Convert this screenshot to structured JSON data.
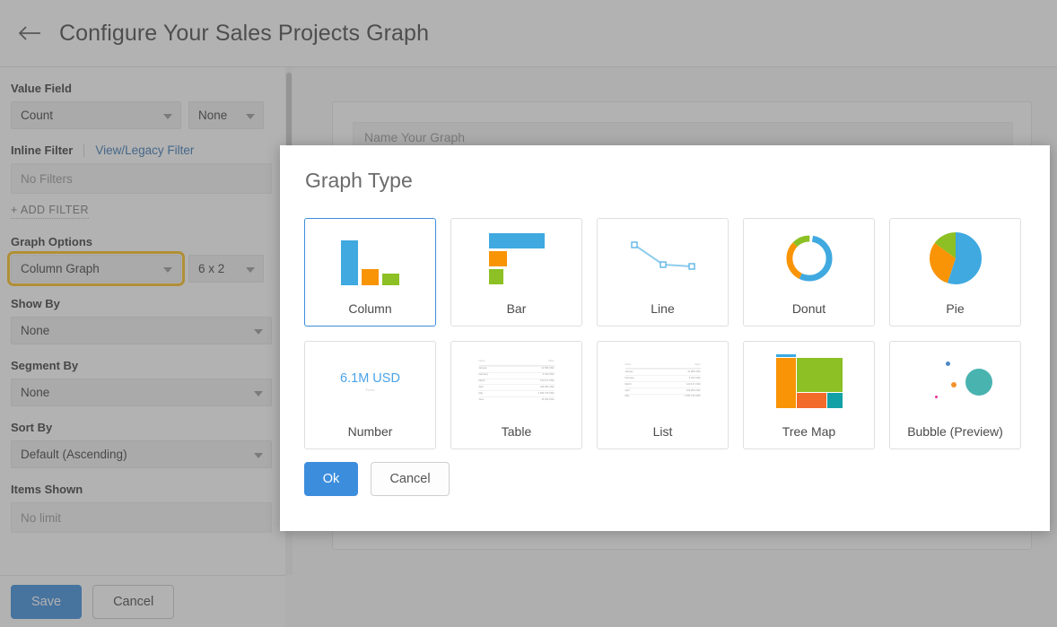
{
  "header": {
    "back_icon": "arrow-left-icon",
    "title": "Configure Your Sales Projects Graph"
  },
  "sidebar": {
    "value_field": {
      "label": "Value Field",
      "primary_value": "Count",
      "secondary_value": "None"
    },
    "inline_filter": {
      "label": "Inline Filter",
      "link_label": "View/Legacy Filter",
      "filter_value": "No Filters",
      "add_filter_label": "+ ADD FILTER"
    },
    "graph_options": {
      "label": "Graph Options",
      "graph_type_value": "Column Graph",
      "size_value": "6 x 2"
    },
    "show_by": {
      "label": "Show By",
      "value": "None"
    },
    "segment_by": {
      "label": "Segment By",
      "value": "None"
    },
    "sort_by": {
      "label": "Sort By",
      "value": "Default (Ascending)"
    },
    "items_shown": {
      "label": "Items Shown",
      "value": "No limit"
    },
    "footer": {
      "save_label": "Save",
      "cancel_label": "Cancel"
    }
  },
  "preview": {
    "graph_name_placeholder": "Name Your Graph"
  },
  "modal": {
    "title": "Graph Type",
    "selected": "Column",
    "ok_label": "Ok",
    "cancel_label": "Cancel",
    "cards": [
      {
        "label": "Column",
        "thumb": "column-chart-thumb"
      },
      {
        "label": "Bar",
        "thumb": "bar-chart-thumb"
      },
      {
        "label": "Line",
        "thumb": "line-chart-thumb"
      },
      {
        "label": "Donut",
        "thumb": "donut-chart-thumb"
      },
      {
        "label": "Pie",
        "thumb": "pie-chart-thumb"
      },
      {
        "label": "Number",
        "thumb": "number-thumb"
      },
      {
        "label": "Table",
        "thumb": "table-thumb"
      },
      {
        "label": "List",
        "thumb": "list-thumb"
      },
      {
        "label": "Tree Map",
        "thumb": "tree-map-thumb"
      },
      {
        "label": "Bubble (Preview)",
        "thumb": "bubble-chart-thumb"
      }
    ],
    "number_thumb": {
      "value": "6.1M USD",
      "sub": "Total"
    },
    "table_thumb": {
      "headers": [
        "Name",
        "Value"
      ],
      "rows": [
        {
          "name": "January",
          "value": "41 580 USD"
        },
        {
          "name": "February",
          "value": "4 040 USD"
        },
        {
          "name": "March",
          "value": "123 117 USD"
        },
        {
          "name": "April",
          "value": "109 280 USD"
        },
        {
          "name": "May",
          "value": "1 250 740 USD"
        },
        {
          "name": "June",
          "value": "15 450 USD"
        }
      ]
    },
    "list_thumb": {
      "headers": [
        "Name",
        "Value"
      ],
      "rows": [
        {
          "name": "January",
          "value": "41 580 USD"
        },
        {
          "name": "February",
          "value": "4 040 USD"
        },
        {
          "name": "March",
          "value": "123 117 USD"
        },
        {
          "name": "April",
          "value": "109 280 USD"
        },
        {
          "name": "May",
          "value": "1 250 740 USD"
        }
      ]
    }
  },
  "colors": {
    "accent_blue": "#3d8ddd",
    "chart_blue": "#3fa9e0",
    "chart_orange": "#f99406",
    "chart_green": "#8cc024",
    "chart_teal": "#49b3b0",
    "highlight_yellow": "#fcbf1e",
    "overlay": "rgba(84,84,84,0.45)"
  }
}
